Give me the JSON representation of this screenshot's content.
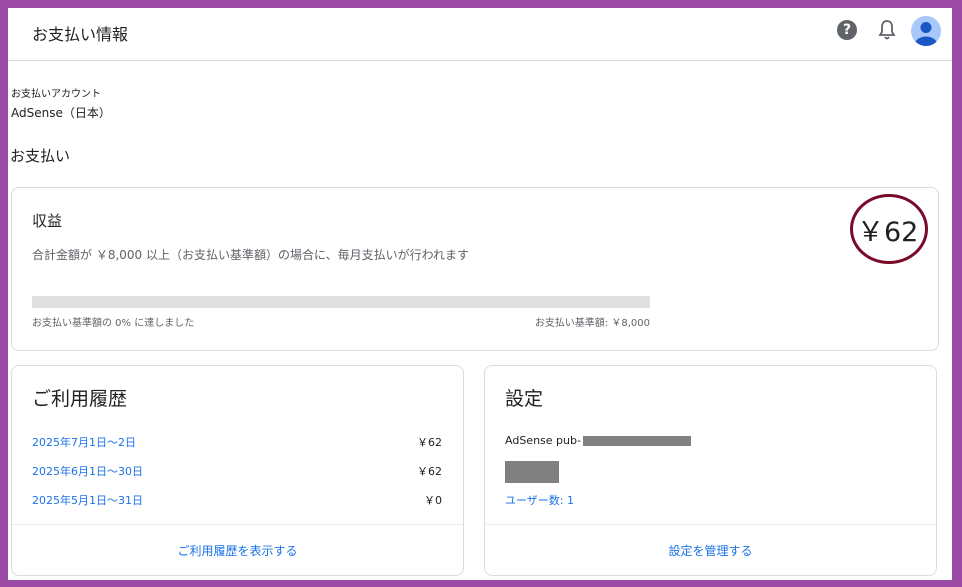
{
  "header": {
    "title": "お支払い情報",
    "help_icon": "help-circle-icon",
    "notifications_icon": "bell-icon",
    "avatar_icon": "account-avatar-icon",
    "help_glyph": "?"
  },
  "account": {
    "label": "お支払いアカウント",
    "value": "AdSense（日本）"
  },
  "payments": {
    "heading": "お支払い"
  },
  "earnings": {
    "title": "収益",
    "description": "合計金額が ￥8,000 以上（お支払い基準額）の場合に、毎月支払いが行われます",
    "amount": "￥62",
    "progress_fraction": 0,
    "progress_label": "お支払い基準額の 0% に達しました",
    "threshold_label": "お支払い基準額: ￥8,000",
    "accent_color": "#1a73e8",
    "annotation_color": "#7a0a2a"
  },
  "history": {
    "title": "ご利用履歴",
    "rows": [
      {
        "period": "2025年7月1日～2日",
        "amount": "￥62"
      },
      {
        "period": "2025年6月1日～30日",
        "amount": "￥62"
      },
      {
        "period": "2025年5月1日～31日",
        "amount": "￥0"
      }
    ],
    "link": "ご利用履歴を表示する"
  },
  "settings": {
    "title": "設定",
    "publisher_id_prefix": "AdSense pub-",
    "users_link": "ユーザー数: 1",
    "link": "設定を管理する"
  }
}
